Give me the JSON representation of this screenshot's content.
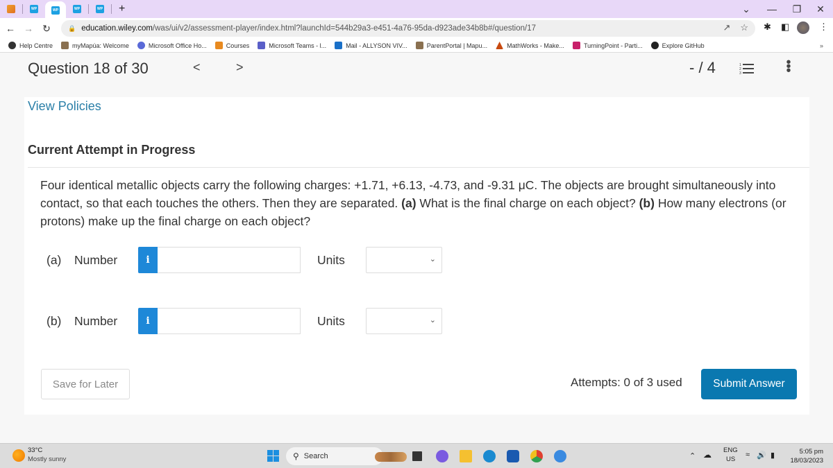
{
  "browser": {
    "tabs": [
      {
        "icon": "courses-favicon"
      },
      {
        "icon": "wiley-favicon",
        "label": "WP"
      },
      {
        "icon": "wiley-favicon",
        "label": "WP",
        "active": true
      },
      {
        "icon": "wiley-favicon",
        "label": "WP"
      },
      {
        "icon": "wiley-favicon",
        "label": "WP"
      }
    ],
    "new_tab_label": "+",
    "url_host": "education.wiley.com",
    "url_path": "/was/ui/v2/assessment-player/index.html?launchId=544b29a3-e451-4a76-95da-d923ade34b8b#/question/17",
    "bookmarks": [
      {
        "label": "Help Centre",
        "color": "#333333"
      },
      {
        "label": "myMapúa: Welcome",
        "color": "#8a7050"
      },
      {
        "label": "Microsoft Office Ho...",
        "color": "#5a6ad8"
      },
      {
        "label": "Courses",
        "color": "#e88a20"
      },
      {
        "label": "Microsoft Teams - l...",
        "color": "#5a5fc8"
      },
      {
        "label": "Mail - ALLYSON VIV...",
        "color": "#1a70c8"
      },
      {
        "label": "ParentPortal | Mapu...",
        "color": "#8a7050"
      },
      {
        "label": "MathWorks - Make...",
        "color": "#c84a10"
      },
      {
        "label": "TurningPoint - Parti...",
        "color": "#c8206a"
      },
      {
        "label": "Explore GitHub",
        "color": "#222222"
      }
    ],
    "more_bookmarks": "»"
  },
  "question_header": {
    "title": "Question 18 of 30",
    "prev": "<",
    "next": ">",
    "score": "- / 4"
  },
  "content": {
    "view_policies": "View Policies",
    "attempt_status": "Current Attempt in Progress",
    "question_text": "Four identical metallic objects carry the following charges: +1.71, +6.13, -4.73, and -9.31 μC. The objects are brought simultaneously into contact, so that each touches the others. Then they are separated.",
    "part_a_prompt": "(a)",
    "part_a_text": " What is the final charge on each object? ",
    "part_b_prompt": "(b)",
    "part_b_text": " How many electrons (or protons) make up the final charge on each object?",
    "answers": [
      {
        "part": "(a)",
        "number_label": "Number",
        "number_value": "",
        "units_label": "Units",
        "units_value": "",
        "info_icon": "i"
      },
      {
        "part": "(b)",
        "number_label": "Number",
        "number_value": "",
        "units_label": "Units",
        "units_value": "",
        "info_icon": "i"
      }
    ],
    "save_label": "Save for Later",
    "attempts_text": "Attempts: 0 of 3 used",
    "submit_label": "Submit Answer"
  },
  "taskbar": {
    "temperature": "33°C",
    "weather": "Mostly sunny",
    "search_label": "Search",
    "language": "ENG",
    "region": "US",
    "time": "5:05 pm",
    "date": "18/03/2023"
  },
  "colors": {
    "accent": "#0a78b0",
    "link": "#2a7fa8",
    "info_badge": "#1e88d8"
  }
}
